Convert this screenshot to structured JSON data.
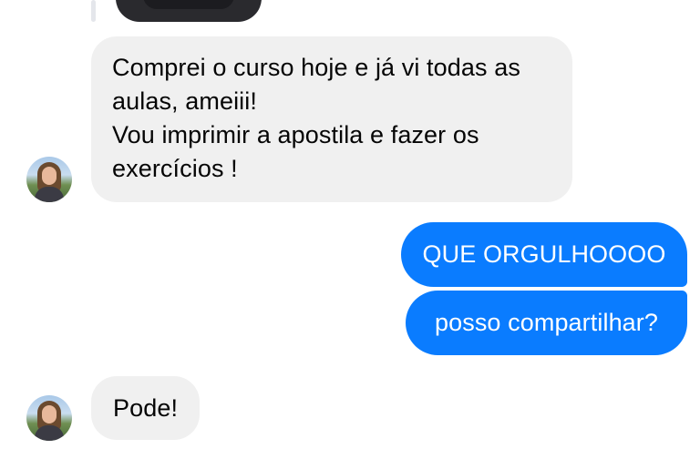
{
  "conversation": {
    "messages": [
      {
        "direction": "incoming",
        "lines": [
          "Comprei o curso hoje e já vi todas as",
          "aulas, ameiii!",
          "Vou imprimir a apostila e fazer os",
          "exercícios !"
        ]
      },
      {
        "direction": "outgoing",
        "text": "QUE ORGULHOOOO"
      },
      {
        "direction": "outgoing",
        "text": "posso compartilhar?"
      },
      {
        "direction": "incoming",
        "text": "Pode!"
      }
    ]
  },
  "colors": {
    "incoming_bubble": "#f0f0f0",
    "outgoing_bubble": "#0a7cff",
    "incoming_text": "#050505",
    "outgoing_text": "#ffffff"
  }
}
